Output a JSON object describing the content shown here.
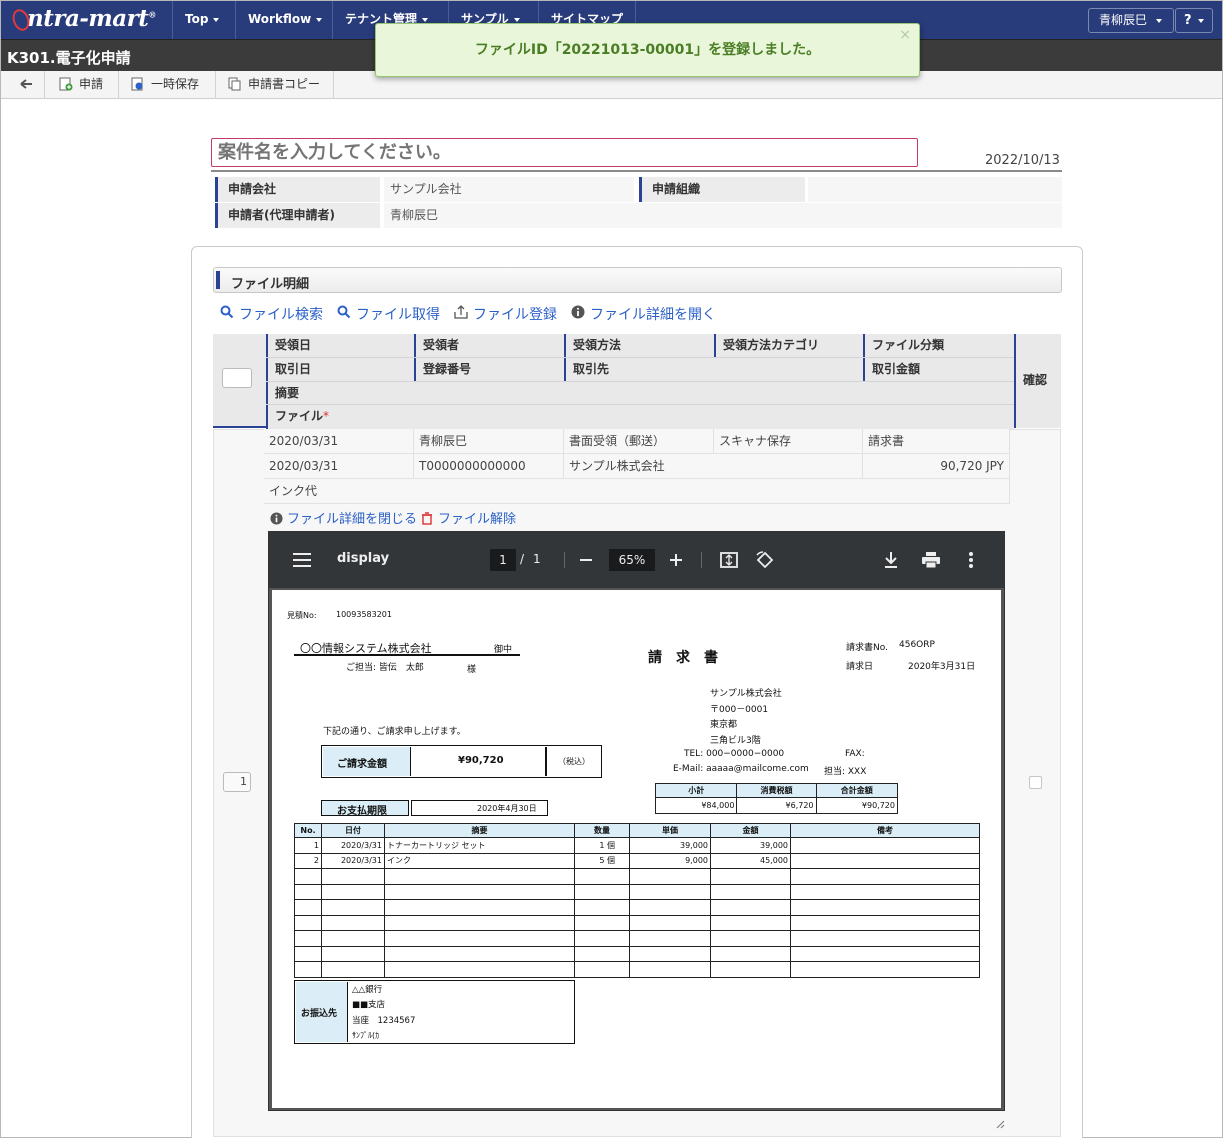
{
  "topnav": {
    "logo": "ntra-mart",
    "logo_mark": "®",
    "items": [
      "Top",
      "Workflow",
      "テナント管理",
      "サンプル",
      "サイトマップ"
    ],
    "user": "青柳辰巳",
    "help": "?"
  },
  "page": {
    "title": "K301.電子化申請"
  },
  "toolbar": {
    "apply": "申請",
    "save_temp": "一時保存",
    "copy": "申請書コピー"
  },
  "toast": {
    "message": "ファイルID「20221013-00001」を登録しました。",
    "close": "×"
  },
  "form": {
    "case_placeholder": "案件名を入力してください。",
    "date": "2022/10/13",
    "company_label": "申請会社",
    "company_value": "サンプル会社",
    "org_label": "申請組織",
    "org_value": "",
    "applicant_label": "申請者(代理申請者)",
    "applicant_value": "青柳辰巳"
  },
  "panel": {
    "title": "ファイル明細",
    "actions": [
      "ファイル検索",
      "ファイル取得",
      "ファイル登録",
      "ファイル詳細を開く"
    ]
  },
  "grid": {
    "headers_row1": [
      "受領日",
      "受領者",
      "受領方法",
      "受領方法カテゴリ",
      "ファイル分類"
    ],
    "headers_row2": [
      "取引日",
      "登録番号",
      "取引先",
      "取引金額"
    ],
    "header_summary": "摘要",
    "header_file": "ファイル",
    "required_mark": "*",
    "header_confirm": "確認",
    "row": {
      "number": "1",
      "received_date": "2020/03/31",
      "receiver": "青柳辰巳",
      "method": "書面受領（郵送）",
      "method_category": "スキャナ保存",
      "file_class": "請求書",
      "trade_date": "2020/03/31",
      "reg_number": "T0000000000000",
      "partner": "サンプル株式会社",
      "amount": "90,720 JPY",
      "summary": "インク代"
    },
    "row_actions": [
      "ファイル詳細を閉じる",
      "ファイル解除"
    ]
  },
  "pdf": {
    "name": "display",
    "page_current": "1",
    "page_sep": "/",
    "page_total": "1",
    "zoom": "65%",
    "doc": {
      "estimate_label": "見積No:",
      "estimate_no": "10093583201",
      "to_company": "〇〇情報システム株式会社",
      "to_honorific": "御中",
      "to_person": "ご担当: 皆伝　太郎",
      "to_person_hon": "様",
      "title": "請　求　書",
      "invoice_no_label": "請求書No.",
      "invoice_no": "456ORP",
      "invoice_date_label": "請求日",
      "invoice_date": "2020年3月31日",
      "from_company": "サンプル株式会社",
      "from_zip": "〒000－0001",
      "from_city": "東京都",
      "from_bldg": "三角ビル3階",
      "from_tel": "TEL: 000−0000−0000",
      "from_fax": "FAX:",
      "from_mail": "E-Mail: aaaaa@mailcome.com",
      "from_person": "担当: XXX",
      "greeting": "下記の通り、ご請求申し上げます。",
      "total_label": "ご請求金額",
      "total_value": "¥90,720",
      "total_tax": "（税込）",
      "due_label": "お支払期限",
      "due_value": "2020年4月30日",
      "sum_headers": [
        "小計",
        "消費税額",
        "合計金額"
      ],
      "sum_values": [
        "¥84,000",
        "¥6,720",
        "¥90,720"
      ],
      "item_headers": [
        "No.",
        "日付",
        "摘要",
        "数量",
        "単価",
        "金額",
        "備考"
      ],
      "items": [
        [
          "1",
          "2020/3/31",
          "トナーカートリッジ セット",
          "1 個",
          "39,000",
          "39,000",
          ""
        ],
        [
          "2",
          "2020/3/31",
          "インク",
          "5 個",
          "9,000",
          "45,000",
          ""
        ]
      ],
      "bank_label": "お振込先",
      "bank_lines": [
        "△△銀行",
        "■■支店",
        "当座　1234567",
        "ｻﾝﾌﾟﾙ(ｶ"
      ]
    }
  }
}
